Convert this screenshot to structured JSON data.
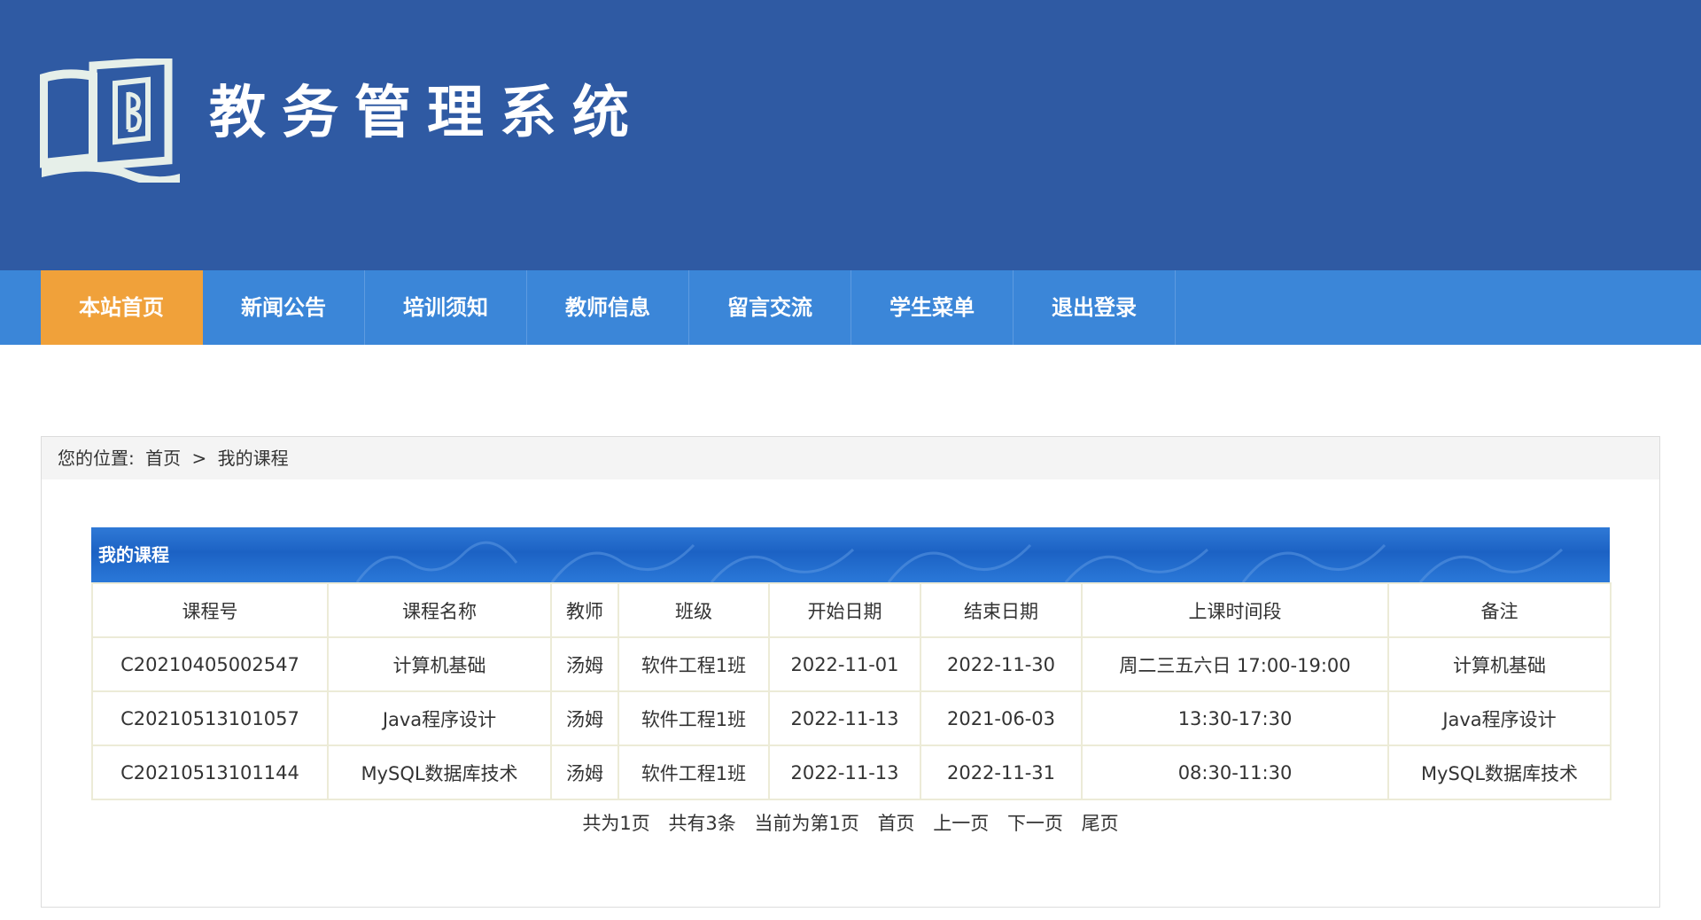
{
  "header": {
    "site_title": "教务管理系统",
    "logo_icon": "open-book-logo-icon",
    "background_color": "#2f5aa3"
  },
  "nav": {
    "background_color": "#3b86d8",
    "active_color": "#f0a13a",
    "items": [
      {
        "label": "本站首页",
        "active": true
      },
      {
        "label": "新闻公告",
        "active": false
      },
      {
        "label": "培训须知",
        "active": false
      },
      {
        "label": "教师信息",
        "active": false
      },
      {
        "label": "留言交流",
        "active": false
      },
      {
        "label": "学生菜单",
        "active": false
      },
      {
        "label": "退出登录",
        "active": false
      }
    ]
  },
  "breadcrumb": {
    "prefix": "您的位置:",
    "home": "首页",
    "separator": ">",
    "current": "我的课程"
  },
  "table": {
    "caption": "我的课程",
    "columns": [
      "课程号",
      "课程名称",
      "教师",
      "班级",
      "开始日期",
      "结束日期",
      "上课时间段",
      "备注"
    ],
    "rows": [
      [
        "C20210405002547",
        "计算机基础",
        "汤姆",
        "软件工程1班",
        "2022-11-01",
        "2022-11-30",
        "周二三五六日 17:00-19:00",
        "计算机基础"
      ],
      [
        "C20210513101057",
        "Java程序设计",
        "汤姆",
        "软件工程1班",
        "2022-11-13",
        "2021-06-03",
        "13:30-17:30",
        "Java程序设计"
      ],
      [
        "C20210513101144",
        "MySQL数据库技术",
        "汤姆",
        "软件工程1班",
        "2022-11-13",
        "2022-11-31",
        "08:30-11:30",
        "MySQL数据库技术"
      ]
    ]
  },
  "pager": {
    "total_pages": "共为1页",
    "total_records": "共有3条",
    "current_page": "当前为第1页",
    "first": "首页",
    "prev": "上一页",
    "next": "下一页",
    "last": "尾页"
  }
}
